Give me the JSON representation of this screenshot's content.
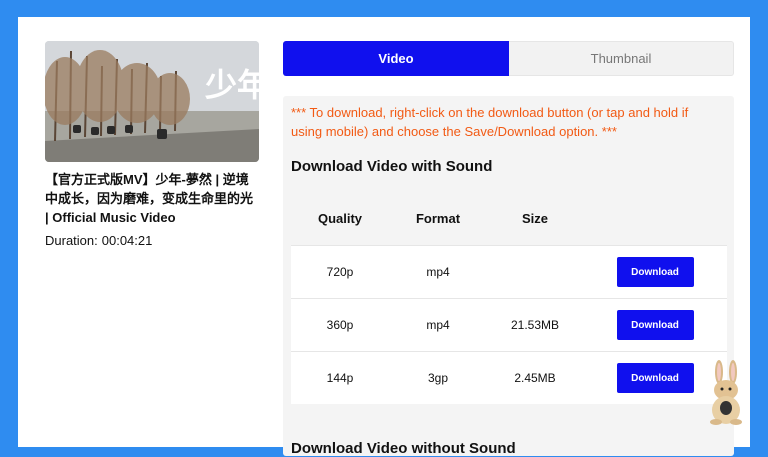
{
  "video": {
    "title": "【官方正式版MV】少年-夢然 | 逆境中成长，因为磨难，变成生命里的光 | Official Music Video",
    "duration_label": "Duration:",
    "duration_value": "00:04:21",
    "thumb_overlay_text": "少年"
  },
  "tabs": [
    {
      "label": "Video",
      "active": true
    },
    {
      "label": "Thumbnail",
      "active": false
    }
  ],
  "notice": "*** To download, right-click on the download button (or tap and hold if using mobile) and choose the Save/Download option. ***",
  "section_with_sound": {
    "title": "Download Video with Sound",
    "headers": {
      "quality": "Quality",
      "format": "Format",
      "size": "Size"
    },
    "rows": [
      {
        "quality": "720p",
        "format": "mp4",
        "size": "",
        "button": "Download"
      },
      {
        "quality": "360p",
        "format": "mp4",
        "size": "21.53MB",
        "button": "Download"
      },
      {
        "quality": "144p",
        "format": "3gp",
        "size": "2.45MB",
        "button": "Download"
      }
    ]
  },
  "section_without_sound": {
    "title": "Download Video without Sound"
  },
  "colors": {
    "accent": "#1010ee",
    "notice": "#f25a14",
    "background": "#2f8cf0"
  }
}
